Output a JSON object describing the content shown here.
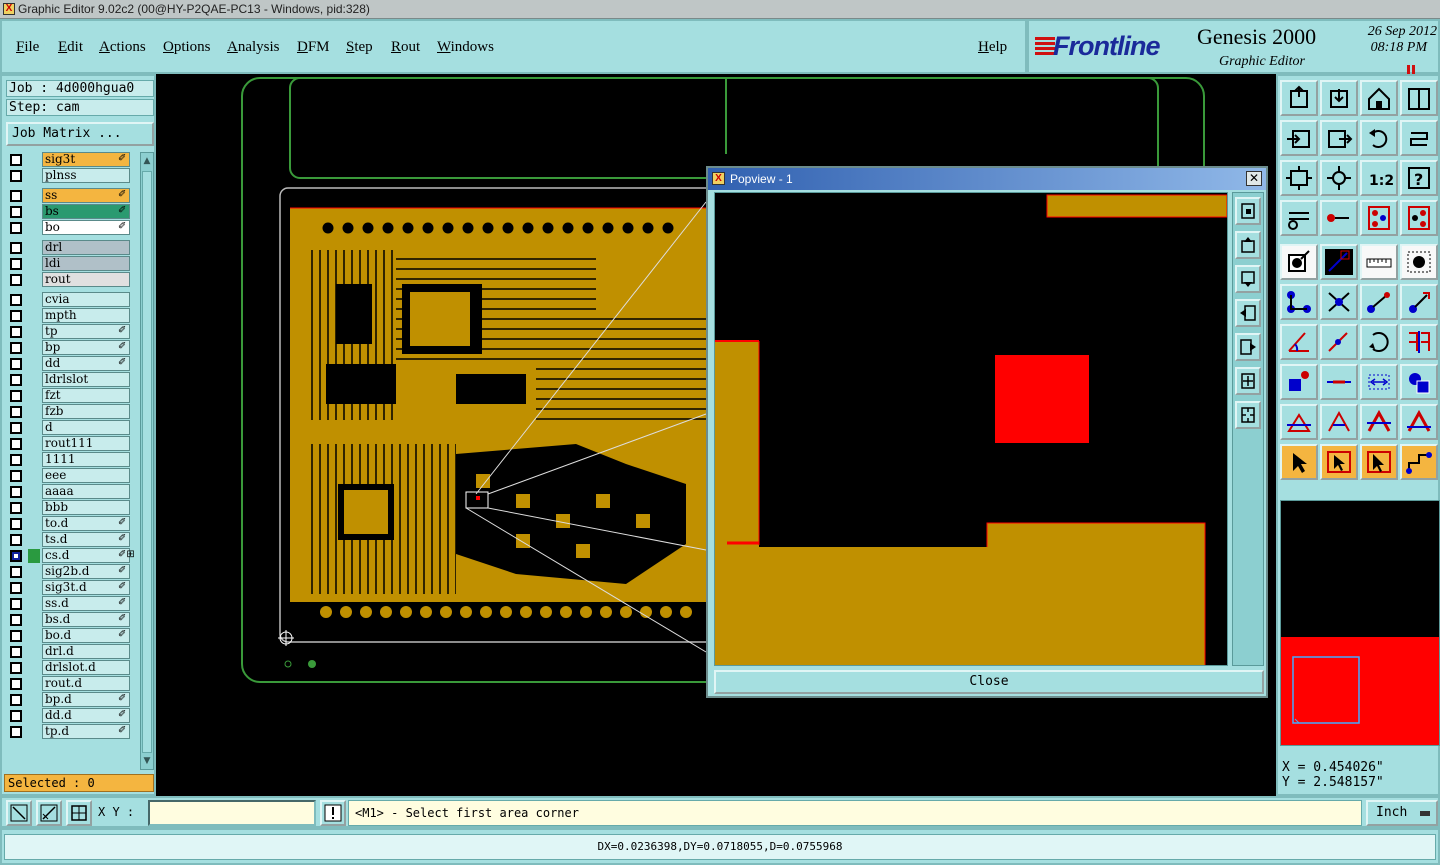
{
  "window": {
    "title": "Graphic Editor 9.02c2 (00@HY-P2QAE-PC13 - Windows, pid:328)"
  },
  "menu": {
    "items": [
      "File",
      "Edit",
      "Actions",
      "Options",
      "Analysis",
      "DFM",
      "Step",
      "Rout",
      "Windows"
    ],
    "help": "Help"
  },
  "branding": {
    "logo": "Frontline",
    "product": "Genesis 2000",
    "subtitle": "Graphic Editor",
    "date": "26 Sep 2012",
    "time": "08:18 PM"
  },
  "job": {
    "job_line": "Job : 4d000hgua0",
    "step_line": "Step: cam",
    "matrix_button": "Job Matrix ..."
  },
  "layers": [
    {
      "name": "sig3t",
      "color": "#f4b540",
      "mark": "✐"
    },
    {
      "name": "plnss",
      "color": "#c8ecec",
      "mark": ""
    },
    {
      "name": "ss",
      "color": "#f4b540",
      "mark": "✐"
    },
    {
      "name": "bs",
      "color": "#2a9a70",
      "mark": "✐"
    },
    {
      "name": "bo",
      "color": "#ffffff",
      "mark": "✐"
    },
    {
      "name": "drl",
      "color": "#b0c0c8",
      "mark": ""
    },
    {
      "name": "ldi",
      "color": "#b0c0c8",
      "mark": ""
    },
    {
      "name": "rout",
      "color": "#e0e0e0",
      "mark": ""
    },
    {
      "name": "cvia",
      "color": "#c8ecec",
      "mark": ""
    },
    {
      "name": "mpth",
      "color": "#c8ecec",
      "mark": ""
    },
    {
      "name": "tp",
      "color": "#c8ecec",
      "mark": "✐"
    },
    {
      "name": "bp",
      "color": "#c8ecec",
      "mark": "✐"
    },
    {
      "name": "dd",
      "color": "#c8ecec",
      "mark": "✐"
    },
    {
      "name": "ldrlslot",
      "color": "#c8ecec",
      "mark": ""
    },
    {
      "name": "fzt",
      "color": "#c8ecec",
      "mark": ""
    },
    {
      "name": "fzb",
      "color": "#c8ecec",
      "mark": ""
    },
    {
      "name": "d",
      "color": "#c8ecec",
      "mark": ""
    },
    {
      "name": "rout111",
      "color": "#c8ecec",
      "mark": ""
    },
    {
      "name": "1111",
      "color": "#c8ecec",
      "mark": ""
    },
    {
      "name": "eee",
      "color": "#c8ecec",
      "mark": ""
    },
    {
      "name": "aaaa",
      "color": "#c8ecec",
      "mark": ""
    },
    {
      "name": "bbb",
      "color": "#c8ecec",
      "mark": ""
    },
    {
      "name": "to.d",
      "color": "#c8ecec",
      "mark": "✐"
    },
    {
      "name": "ts.d",
      "color": "#c8ecec",
      "mark": "✐"
    },
    {
      "name": "cs.d",
      "color": "#c8ecec",
      "mark": "✐⊞",
      "active": true
    },
    {
      "name": "sig2b.d",
      "color": "#c8ecec",
      "mark": "✐"
    },
    {
      "name": "sig3t.d",
      "color": "#c8ecec",
      "mark": "✐"
    },
    {
      "name": "ss.d",
      "color": "#c8ecec",
      "mark": "✐"
    },
    {
      "name": "bs.d",
      "color": "#c8ecec",
      "mark": "✐"
    },
    {
      "name": "bo.d",
      "color": "#c8ecec",
      "mark": "✐"
    },
    {
      "name": "drl.d",
      "color": "#c8ecec",
      "mark": ""
    },
    {
      "name": "drlslot.d",
      "color": "#c8ecec",
      "mark": ""
    },
    {
      "name": "rout.d",
      "color": "#c8ecec",
      "mark": ""
    },
    {
      "name": "bp.d",
      "color": "#c8ecec",
      "mark": "✐"
    },
    {
      "name": "dd.d",
      "color": "#c8ecec",
      "mark": "✐"
    },
    {
      "name": "tp.d",
      "color": "#c8ecec",
      "mark": "✐"
    }
  ],
  "selection": {
    "text": "Selected : 0"
  },
  "popview": {
    "title": "Popview - 1",
    "close_label": "Close"
  },
  "cursor": {
    "x": "X = 0.454026\"",
    "y": "Y = 2.548157\""
  },
  "command": {
    "xy_label": "X Y :",
    "xy_value": "",
    "prompt": "<M1> - Select first area corner",
    "unit": "Inch"
  },
  "status": {
    "text": "DX=0.0236398,DY=0.0718055,D=0.0755968"
  },
  "colors": {
    "panel": "#a5dfe0",
    "copper": "#c09000",
    "highlight": "#ff0000",
    "outline": "#3a9a3a"
  }
}
